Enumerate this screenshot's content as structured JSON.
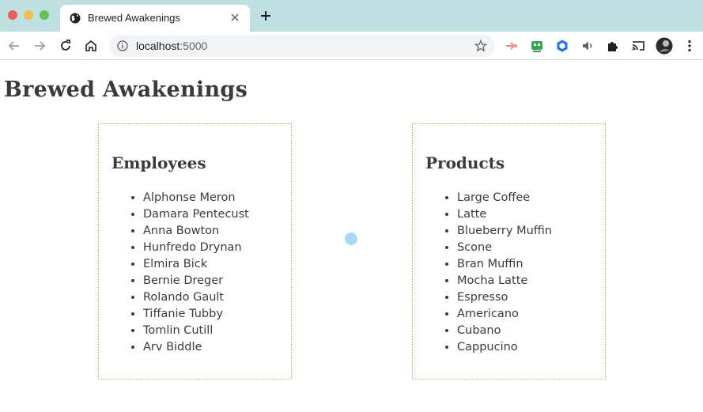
{
  "browser": {
    "tab_title": "Brewed Awakenings",
    "url_host": "localhost",
    "url_port": ":5000"
  },
  "page": {
    "title": "Brewed Awakenings"
  },
  "employees": {
    "heading": "Employees",
    "items": [
      "Alphonse Meron",
      "Damara Pentecust",
      "Anna Bowton",
      "Hunfredo Drynan",
      "Elmira Bick",
      "Bernie Dreger",
      "Rolando Gault",
      "Tiffanie Tubby",
      "Tomlin Cutill",
      "Arv Biddle"
    ]
  },
  "products": {
    "heading": "Products",
    "items": [
      "Large Coffee",
      "Latte",
      "Blueberry Muffin",
      "Scone",
      "Bran Muffin",
      "Mocha Latte",
      "Espresso",
      "Americano",
      "Cubano",
      "Cappucino"
    ]
  }
}
